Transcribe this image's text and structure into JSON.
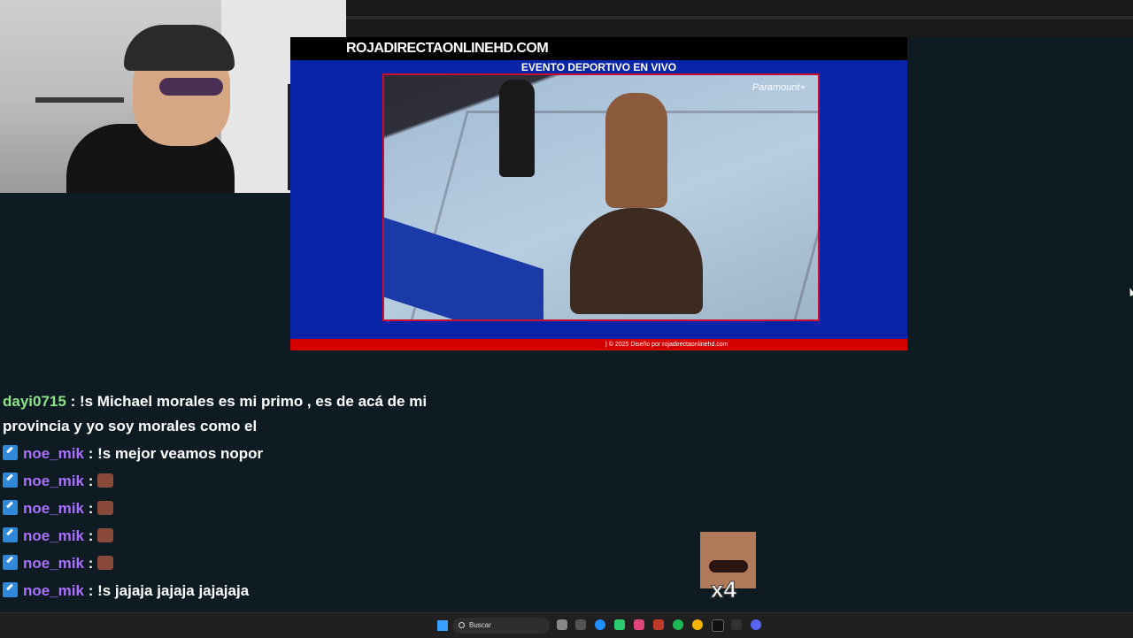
{
  "site": {
    "logo": "ROJADIRECTAONLINEHD.COM",
    "event_title": "EVENTO DEPORTIVO EN VIVO",
    "player_watermark": "Paramount+",
    "footer": "| © 2025 Diseño por rojadirectaonlinehd.com"
  },
  "chat": {
    "messages": [
      {
        "user": "dayi0715",
        "sep": " : ",
        "text": "!s Michael morales es mi primo , es de acá de mi provincia y yo soy morales como el"
      },
      {
        "user": "noe_mik",
        "sep": " : ",
        "text": "!s mejor veamos nopor"
      },
      {
        "user": "noe_mik",
        "sep": " : ",
        "text": ""
      },
      {
        "user": "noe_mik",
        "sep": " : ",
        "text": ""
      },
      {
        "user": "noe_mik",
        "sep": " : ",
        "text": ""
      },
      {
        "user": "noe_mik",
        "sep": " : ",
        "text": ""
      },
      {
        "user": "noe_mik",
        "sep": " : ",
        "text": "!s jajaja jajaja jajajaja"
      }
    ]
  },
  "emote_overlay": {
    "count": "x4"
  },
  "taskbar": {
    "search_placeholder": "Buscar"
  },
  "icons": [
    "windows-start-icon",
    "search-icon",
    "task-view-icon",
    "edge-icon",
    "spotify-icon",
    "chrome-icon",
    "tiktok-icon",
    "discord-icon"
  ],
  "colors": {
    "site_bg": "#0a24a8",
    "footer_bar": "#d40000",
    "player_border": "#c8102e",
    "user_green": "#8fe387",
    "user_purple": "#a970ff"
  }
}
